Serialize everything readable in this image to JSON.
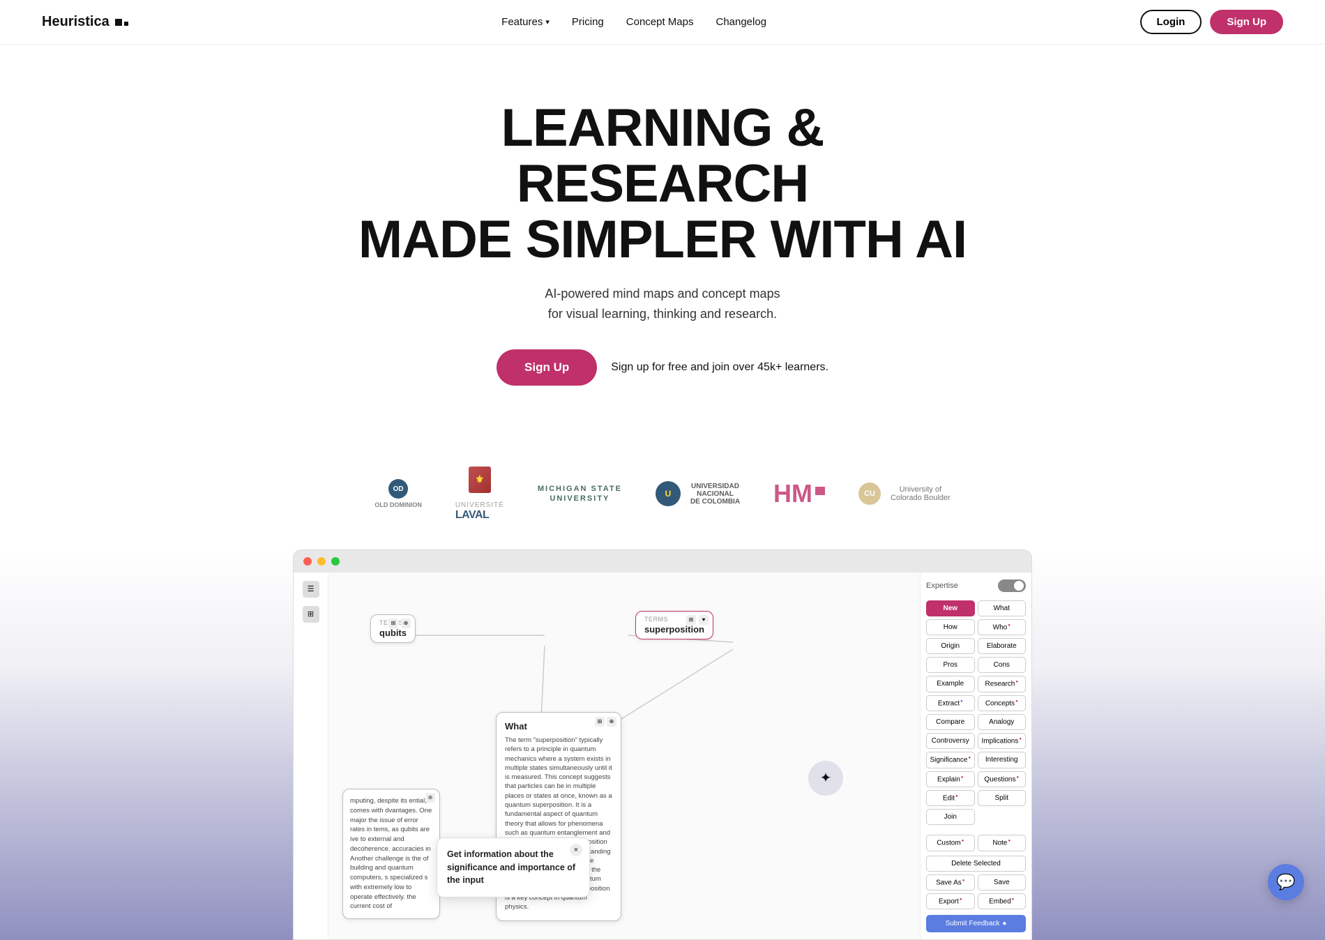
{
  "nav": {
    "logo": "Heuristica",
    "links": [
      {
        "label": "Features",
        "has_dropdown": true
      },
      {
        "label": "Pricing"
      },
      {
        "label": "Concept Maps"
      },
      {
        "label": "Changelog"
      }
    ],
    "login_label": "Login",
    "signup_label": "Sign Up"
  },
  "hero": {
    "headline_line1": "LEARNING & RESEARCH",
    "headline_line2": "MADE SIMPLER WITH AI",
    "subtext_line1": "AI-powered mind maps and concept maps",
    "subtext_line2": "for visual learning, thinking and research.",
    "cta_button": "Sign Up",
    "cta_note": "Sign up for free and join over 45k+ learners."
  },
  "logos": [
    {
      "name": "Old Dominion"
    },
    {
      "name": "Université Laval"
    },
    {
      "name": "Michigan State University"
    },
    {
      "name": "Universidad Nacional de Colombia"
    },
    {
      "name": "HM"
    },
    {
      "name": "University of Colorado Boulder"
    }
  ],
  "app": {
    "expertise_label": "Expertise",
    "nodes": [
      {
        "label": "TERMS",
        "title": "qubits"
      },
      {
        "label": "TERMS",
        "title": "superposition"
      }
    ],
    "what_card": {
      "header": "What",
      "text": "The term \"superposition\" typically refers to a principle in quantum mechanics where a system exists in multiple states simultaneously until it is measured. This concept suggests that particles can be in multiple places or states at once, known as a quantum superposition. It is a fundamental aspect of quantum theory that allows for phenomena such as quantum entanglement and quantum computing. Superposition plays a crucial role in understanding the behavior of particles at the quantum level and has led to the development of various quantum technologies. Overall, superposition is a key concept in quantum physics."
    },
    "computing_card_text": "mputing, despite its ential, comes with dvantages. One major the issue of error rates in tems, as qubits are ive to external and decoherence. accuracies in Another challenge is the of building and quantum computers, s specialized s with extremely low to operate effectively. the current cost of",
    "tooltip": {
      "text": "Get information about the significance and importance of the input",
      "close": "×"
    },
    "panel_buttons": [
      {
        "row": [
          {
            "label": "New",
            "style": "pink"
          },
          {
            "label": "What"
          }
        ]
      },
      {
        "row": [
          {
            "label": "How"
          },
          {
            "label": "Who",
            "dot": "pink"
          }
        ]
      },
      {
        "row": [
          {
            "label": "Origin"
          },
          {
            "label": "Elaborate"
          }
        ]
      },
      {
        "row": [
          {
            "label": "Pros"
          },
          {
            "label": "Cons"
          }
        ]
      },
      {
        "row": [
          {
            "label": "Example"
          },
          {
            "label": "Research",
            "dot": "pink"
          }
        ]
      },
      {
        "row": [
          {
            "label": "Extract",
            "dot": "blue"
          },
          {
            "label": "Concepts",
            "dot": "pink"
          }
        ]
      },
      {
        "row": [
          {
            "label": "Compare"
          },
          {
            "label": "Analogy"
          }
        ]
      },
      {
        "row": [
          {
            "label": "Controversy"
          },
          {
            "label": "Implications",
            "dot": "pink"
          }
        ]
      },
      {
        "row": [
          {
            "label": "Significance",
            "dot": "pink"
          },
          {
            "label": "Interesting"
          }
        ]
      },
      {
        "row": [
          {
            "label": "Explain",
            "dot": "pink"
          },
          {
            "label": "Questions",
            "dot": "pink"
          }
        ]
      },
      {
        "row": [
          {
            "label": "Edit",
            "dot": "pink"
          },
          {
            "label": "Split"
          }
        ]
      },
      {
        "row": [
          {
            "label": "Join"
          }
        ]
      },
      {
        "row": [
          {
            "label": "Custom",
            "dot": "pink"
          },
          {
            "label": "Note",
            "dot": "pink"
          }
        ]
      },
      {
        "row": [
          {
            "label": "Delete Selected",
            "full": true
          }
        ]
      },
      {
        "row": [
          {
            "label": "Save As",
            "dot": "pink"
          },
          {
            "label": "Save"
          }
        ]
      },
      {
        "row": [
          {
            "label": "Export",
            "dot": "pink"
          },
          {
            "label": "Embed",
            "dot": "pink"
          }
        ]
      },
      {
        "row": [
          {
            "label": "Submit Feedback",
            "style": "submit",
            "dot": "blue"
          }
        ]
      }
    ]
  },
  "chat": {
    "icon": "💬"
  }
}
